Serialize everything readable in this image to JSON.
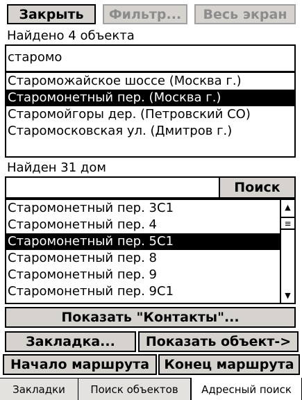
{
  "toolbar": {
    "close": "Закрыть",
    "filter": "Фильтр...",
    "fullscreen": "Весь экран"
  },
  "objects": {
    "found_label": "Найдено 4 объекта",
    "search_value": "старомо",
    "items": [
      "Староможайское шоссе (Москва г.)",
      "Старомонетный пер. (Москва г.)",
      "Старомойгоры дер. (Петровский СО)",
      "Старомосковская ул. (Дмитров г.)"
    ],
    "selected_index": 1
  },
  "houses": {
    "found_label": "Найден 31 дом",
    "search_value": "",
    "search_button": "Поиск",
    "items": [
      "Старомонетный пер. 3С1",
      "Старомонетный пер. 4",
      "Старомонетный пер. 5С1",
      "Старомонетный пер. 8",
      "Старомонетный пер. 9",
      "Старомонетный пер. 9С1"
    ],
    "selected_index": 2
  },
  "actions": {
    "show_contacts": "Показать \"Контакты\"...",
    "bookmark": "Закладка...",
    "show_object": "Показать объект->",
    "route_start": "Начало маршрута",
    "route_end": "Конец маршрута"
  },
  "tabs": [
    {
      "label": "Закладки",
      "active": false
    },
    {
      "label": "Поиск объектов",
      "active": false
    },
    {
      "label": "Адресный поиск",
      "active": true
    }
  ],
  "icons": {
    "scroll_up": "up-arrow-icon",
    "scroll_down": "down-arrow-icon",
    "scroll_thumb": "grip-icon"
  }
}
